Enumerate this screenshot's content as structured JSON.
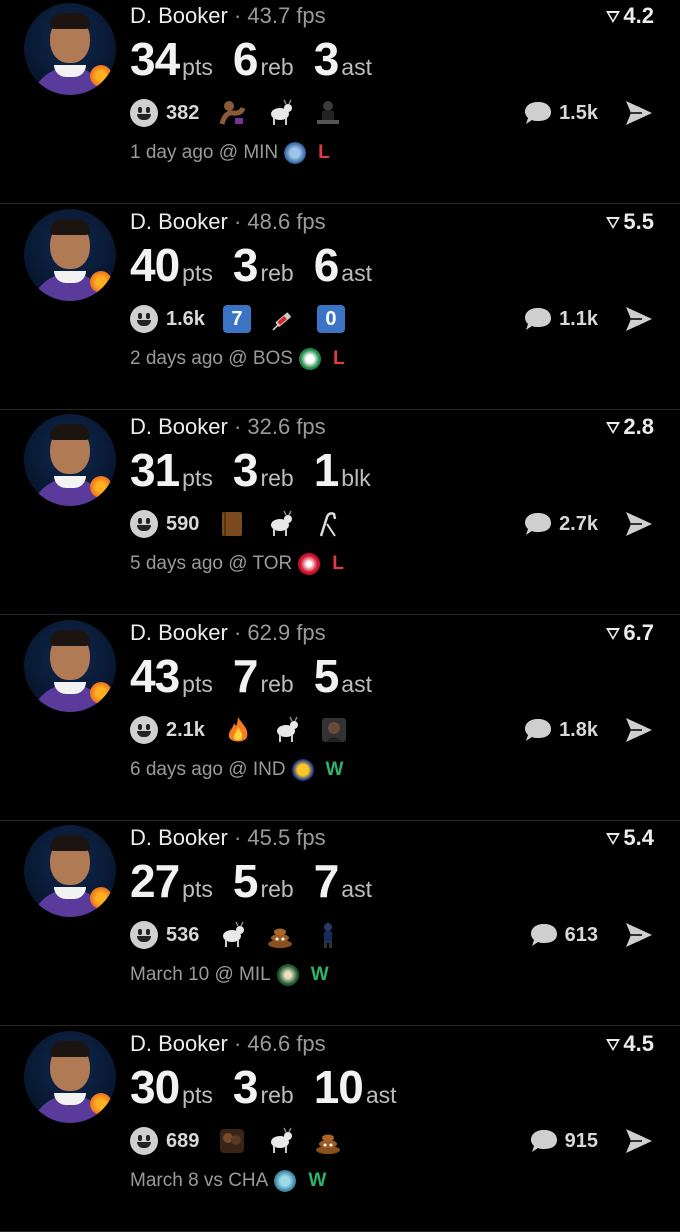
{
  "cards": [
    {
      "name": "D. Booker",
      "fps": "43.7 fps",
      "rating": "4.2",
      "stats": [
        {
          "value": "34",
          "unit": "pts"
        },
        {
          "value": "6",
          "unit": "reb"
        },
        {
          "value": "3",
          "unit": "ast"
        }
      ],
      "reactions": "382",
      "emojis": [
        "flexing-person-emoji",
        "goat-emoji",
        "person-at-desk-emoji"
      ],
      "comments": "1.5k",
      "when": "1 day ago",
      "at": "@ MIN",
      "opponent_logo": "timberwolves-logo",
      "result": "L"
    },
    {
      "name": "D. Booker",
      "fps": "48.6 fps",
      "rating": "5.5",
      "stats": [
        {
          "value": "40",
          "unit": "pts"
        },
        {
          "value": "3",
          "unit": "reb"
        },
        {
          "value": "6",
          "unit": "ast"
        }
      ],
      "reactions": "1.6k",
      "emojis": [
        "keycap-7-emoji",
        "syringe-emoji",
        "keycap-0-emoji"
      ],
      "emoji_text": [
        "7",
        "",
        "0"
      ],
      "comments": "1.1k",
      "when": "2 days ago",
      "at": "@ BOS",
      "opponent_logo": "celtics-logo",
      "result": "L"
    },
    {
      "name": "D. Booker",
      "fps": "32.6 fps",
      "rating": "2.8",
      "stats": [
        {
          "value": "31",
          "unit": "pts"
        },
        {
          "value": "3",
          "unit": "reb"
        },
        {
          "value": "1",
          "unit": "blk"
        }
      ],
      "reactions": "590",
      "emojis": [
        "book-emoji",
        "goat-emoji",
        "walking-cane-emoji"
      ],
      "comments": "2.7k",
      "when": "5 days ago",
      "at": "@ TOR",
      "opponent_logo": "raptors-logo",
      "result": "L"
    },
    {
      "name": "D. Booker",
      "fps": "62.9 fps",
      "rating": "6.7",
      "stats": [
        {
          "value": "43",
          "unit": "pts"
        },
        {
          "value": "7",
          "unit": "reb"
        },
        {
          "value": "5",
          "unit": "ast"
        }
      ],
      "reactions": "2.1k",
      "emojis": [
        "fire-emoji",
        "goat-emoji",
        "hooded-person-emoji"
      ],
      "comments": "1.8k",
      "when": "6 days ago",
      "at": "@ IND",
      "opponent_logo": "pacers-logo",
      "result": "W"
    },
    {
      "name": "D. Booker",
      "fps": "45.5 fps",
      "rating": "5.4",
      "stats": [
        {
          "value": "27",
          "unit": "pts"
        },
        {
          "value": "5",
          "unit": "reb"
        },
        {
          "value": "7",
          "unit": "ast"
        }
      ],
      "reactions": "536",
      "emojis": [
        "goat-emoji",
        "poop-emoji",
        "player-emoji"
      ],
      "comments": "613",
      "when": "March 10",
      "at": "@ MIL",
      "opponent_logo": "bucks-logo",
      "result": "W"
    },
    {
      "name": "D. Booker",
      "fps": "46.6 fps",
      "rating": "4.5",
      "stats": [
        {
          "value": "30",
          "unit": "pts"
        },
        {
          "value": "3",
          "unit": "reb"
        },
        {
          "value": "10",
          "unit": "ast"
        }
      ],
      "reactions": "689",
      "emojis": [
        "bear-hug-emoji",
        "goat-emoji",
        "poop-emoji"
      ],
      "comments": "915",
      "when": "March 8",
      "at": "vs CHA",
      "opponent_logo": "hornets-logo",
      "result": "W"
    }
  ],
  "colors": {
    "background": "#000000",
    "loss": "#e23b3b",
    "win": "#2fb36a",
    "muted": "#9a9a9a"
  }
}
